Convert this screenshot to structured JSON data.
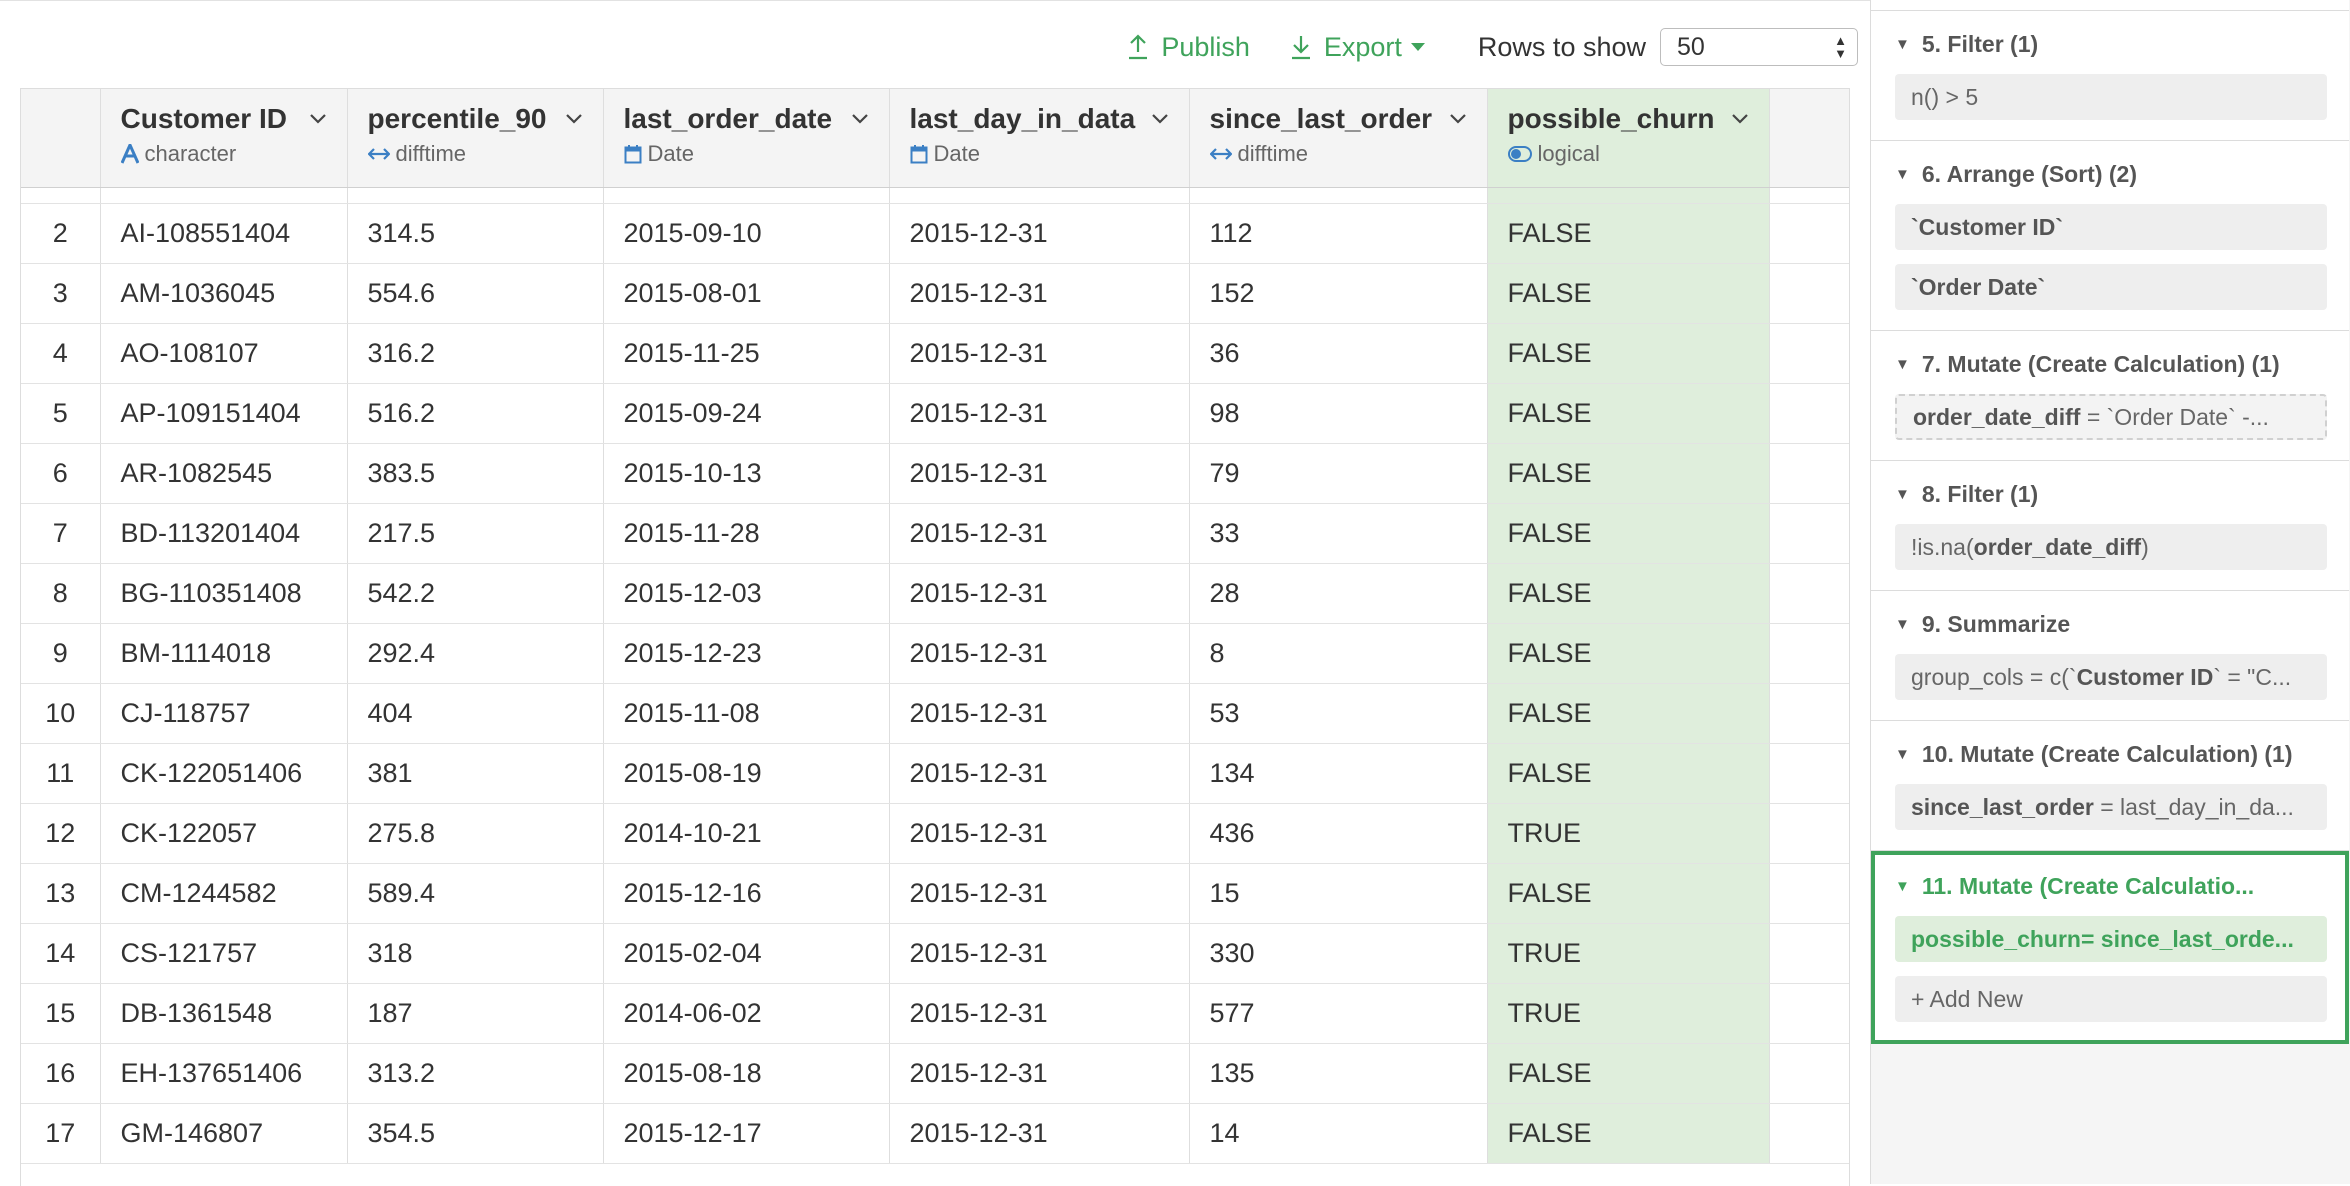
{
  "toolbar": {
    "publish_label": "Publish",
    "export_label": "Export",
    "rows_label": "Rows to show",
    "rows_value": "50"
  },
  "columns": [
    {
      "name": "Customer ID",
      "type": "character",
      "type_icon": "character-A-icon"
    },
    {
      "name": "percentile_90",
      "type": "difftime",
      "type_icon": "double-arrow-icon"
    },
    {
      "name": "last_order_date",
      "type": "Date",
      "type_icon": "calendar-icon"
    },
    {
      "name": "last_day_in_data",
      "type": "Date",
      "type_icon": "calendar-icon"
    },
    {
      "name": "since_last_order",
      "type": "difftime",
      "type_icon": "double-arrow-icon"
    },
    {
      "name": "possible_churn",
      "type": "logical",
      "type_icon": "toggle-icon"
    }
  ],
  "rows": [
    {
      "n": "2",
      "cells": [
        "AI-108551404",
        "314.5",
        "2015-09-10",
        "2015-12-31",
        "112",
        "FALSE"
      ]
    },
    {
      "n": "3",
      "cells": [
        "AM-1036045",
        "554.6",
        "2015-08-01",
        "2015-12-31",
        "152",
        "FALSE"
      ]
    },
    {
      "n": "4",
      "cells": [
        "AO-108107",
        "316.2",
        "2015-11-25",
        "2015-12-31",
        "36",
        "FALSE"
      ]
    },
    {
      "n": "5",
      "cells": [
        "AP-109151404",
        "516.2",
        "2015-09-24",
        "2015-12-31",
        "98",
        "FALSE"
      ]
    },
    {
      "n": "6",
      "cells": [
        "AR-1082545",
        "383.5",
        "2015-10-13",
        "2015-12-31",
        "79",
        "FALSE"
      ]
    },
    {
      "n": "7",
      "cells": [
        "BD-113201404",
        "217.5",
        "2015-11-28",
        "2015-12-31",
        "33",
        "FALSE"
      ]
    },
    {
      "n": "8",
      "cells": [
        "BG-110351408",
        "542.2",
        "2015-12-03",
        "2015-12-31",
        "28",
        "FALSE"
      ]
    },
    {
      "n": "9",
      "cells": [
        "BM-1114018",
        "292.4",
        "2015-12-23",
        "2015-12-31",
        "8",
        "FALSE"
      ]
    },
    {
      "n": "10",
      "cells": [
        "CJ-118757",
        "404",
        "2015-11-08",
        "2015-12-31",
        "53",
        "FALSE"
      ]
    },
    {
      "n": "11",
      "cells": [
        "CK-122051406",
        "381",
        "2015-08-19",
        "2015-12-31",
        "134",
        "FALSE"
      ]
    },
    {
      "n": "12",
      "cells": [
        "CK-122057",
        "275.8",
        "2014-10-21",
        "2015-12-31",
        "436",
        "TRUE"
      ]
    },
    {
      "n": "13",
      "cells": [
        "CM-1244582",
        "589.4",
        "2015-12-16",
        "2015-12-31",
        "15",
        "FALSE"
      ]
    },
    {
      "n": "14",
      "cells": [
        "CS-121757",
        "318",
        "2015-02-04",
        "2015-12-31",
        "330",
        "TRUE"
      ]
    },
    {
      "n": "15",
      "cells": [
        "DB-1361548",
        "187",
        "2014-06-02",
        "2015-12-31",
        "577",
        "TRUE"
      ]
    },
    {
      "n": "16",
      "cells": [
        "EH-137651406",
        "313.2",
        "2015-08-18",
        "2015-12-31",
        "135",
        "FALSE"
      ]
    },
    {
      "n": "17",
      "cells": [
        "GM-146807",
        "354.5",
        "2015-12-17",
        "2015-12-31",
        "14",
        "FALSE"
      ]
    }
  ],
  "steps": [
    {
      "title": "5. Filter (1)",
      "chips": [
        {
          "parts": [
            {
              "t": "n() > 5",
              "b": false
            }
          ]
        }
      ]
    },
    {
      "title": "6. Arrange (Sort) (2)",
      "chips": [
        {
          "parts": [
            {
              "t": "`Customer ID`",
              "b": true
            }
          ]
        },
        {
          "parts": [
            {
              "t": "`Order Date`",
              "b": true
            }
          ]
        }
      ]
    },
    {
      "title": "7. Mutate (Create Calculation) (1)",
      "chips": [
        {
          "dashed": true,
          "parts": [
            {
              "t": "order_date_diff",
              "b": true
            },
            {
              "t": " = `Order Date` -...",
              "b": false
            }
          ]
        }
      ]
    },
    {
      "title": "8. Filter (1)",
      "chips": [
        {
          "parts": [
            {
              "t": "!is.na(",
              "b": false
            },
            {
              "t": "order_date_diff",
              "b": true
            },
            {
              "t": ")",
              "b": false
            }
          ]
        }
      ]
    },
    {
      "title": "9. Summarize",
      "chips": [
        {
          "parts": [
            {
              "t": "group_cols = c(`",
              "b": false
            },
            {
              "t": "Customer ID",
              "b": true
            },
            {
              "t": "` = \"C...",
              "b": false
            }
          ]
        }
      ]
    },
    {
      "title": "10. Mutate (Create Calculation) (1)",
      "chips": [
        {
          "parts": [
            {
              "t": "since_last_order",
              "b": true
            },
            {
              "t": " = last_day_in_da...",
              "b": false
            }
          ]
        }
      ]
    }
  ],
  "active_step": {
    "title": "11. Mutate (Create Calculatio...",
    "chip_name": "possible_churn",
    "chip_rest": " = since_last_orde...",
    "add_label": "+ Add New"
  },
  "colors": {
    "accent": "#3fa35b",
    "highlight": "#dfeedc",
    "type_icon": "#3b7fc4"
  }
}
